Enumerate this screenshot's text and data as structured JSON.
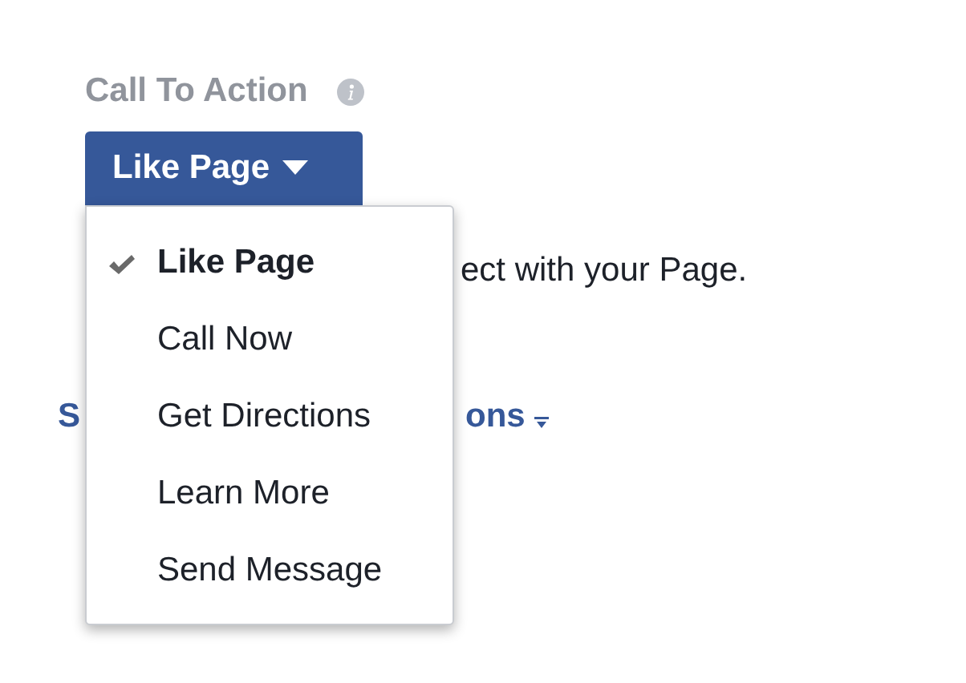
{
  "field": {
    "label": "Call To Action",
    "button": "Like Page"
  },
  "description_fragment": "ect with your Page.",
  "link_fragments": [
    "S",
    "ons"
  ],
  "menu": {
    "items": [
      {
        "label": "Like Page",
        "selected": true
      },
      {
        "label": "Call Now",
        "selected": false
      },
      {
        "label": "Get Directions",
        "selected": false
      },
      {
        "label": "Learn More",
        "selected": false
      },
      {
        "label": "Send Message",
        "selected": false
      }
    ]
  }
}
